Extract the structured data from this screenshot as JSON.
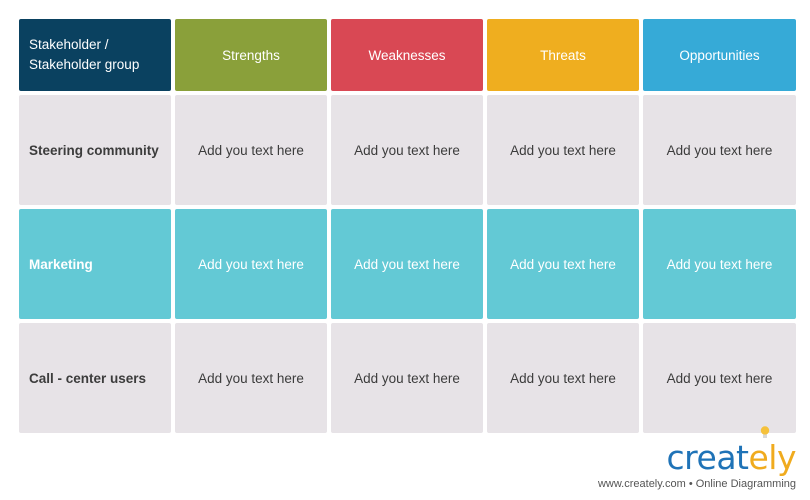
{
  "header": {
    "stakeholder_label": "Stakeholder / Stakeholder group",
    "columns": [
      {
        "label": "Strengths",
        "color": "#8aa03a"
      },
      {
        "label": "Weaknesses",
        "color": "#d94854"
      },
      {
        "label": "Threats",
        "color": "#efae1f"
      },
      {
        "label": "Opportunities",
        "color": "#36aad7"
      }
    ],
    "stakeholder_color": "#0a4160"
  },
  "rows": [
    {
      "label": "Steering community",
      "cells": [
        "Add you text here",
        "Add you text here",
        "Add you text here",
        "Add you text here"
      ],
      "style": "gray"
    },
    {
      "label": "Marketing",
      "cells": [
        "Add you text here",
        "Add you text here",
        "Add you text here",
        "Add you text here"
      ],
      "style": "teal"
    },
    {
      "label": "Call - center users",
      "cells": [
        "Add you text here",
        "Add you text here",
        "Add you text here",
        "Add you text here"
      ],
      "style": "gray"
    }
  ],
  "branding": {
    "logo_main": "creat",
    "logo_accent": "ely",
    "tagline": "www.creately.com • Online Diagramming"
  }
}
